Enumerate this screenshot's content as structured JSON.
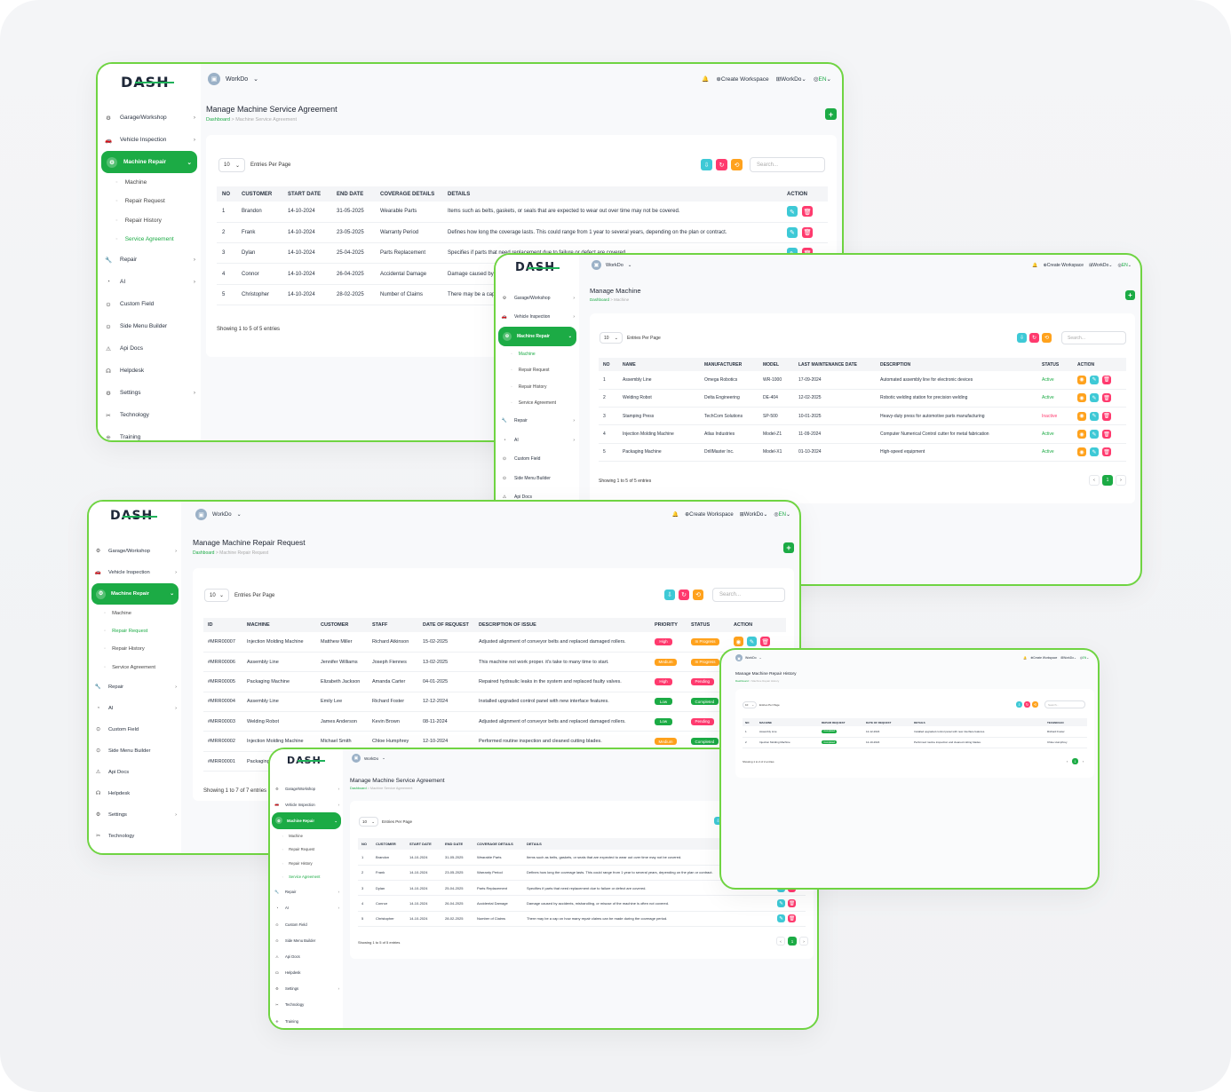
{
  "brand": {
    "logo": "DASH",
    "workspace": "WorkDo",
    "lang": "EN",
    "create_workspace": "Create Workspace",
    "accent": "#1cab45",
    "frame": "#6fd442"
  },
  "nav": {
    "garage": "Garage/Workshop",
    "vehicle": "Vehicle Inspection",
    "machine_repair": "Machine Repair",
    "sub_machine": "Machine",
    "sub_request": "Repair Request",
    "sub_history": "Repair History",
    "sub_agreement": "Service Agreement",
    "repair": "Repair",
    "ai": "AI",
    "custom_field": "Custom Field",
    "side_menu": "Side Menu Builder",
    "api_docs": "Api Docs",
    "helpdesk": "Helpdesk",
    "settings": "Settings",
    "technology": "Technology",
    "training": "Training"
  },
  "common": {
    "dashboard": "Dashboard",
    "entries_per_page": "Entries Per Page",
    "per_page_value": "10",
    "search_placeholder": "Search...",
    "page": "1"
  },
  "agreement": {
    "title": "Manage Machine Service Agreement",
    "crumb": "Machine Service Agreement",
    "columns": [
      "NO",
      "CUSTOMER",
      "START DATE",
      "END DATE",
      "COVERAGE DETAILS",
      "DETAILS",
      "ACTION"
    ],
    "rows": [
      [
        "1",
        "Brandon",
        "14-10-2024",
        "31-05-2025",
        "Wearable Parts",
        "Items such as belts, gaskets, or seals that are expected to wear out over time may not be covered."
      ],
      [
        "2",
        "Frank",
        "14-10-2024",
        "23-05-2025",
        "Warranty Period",
        "Defines how long the coverage lasts. This could range from 1 year to several years, depending on the plan or contract."
      ],
      [
        "3",
        "Dylan",
        "14-10-2024",
        "25-04-2025",
        "Parts Replacement",
        "Specifies if parts that need replacement due to failure or defect are covered."
      ],
      [
        "4",
        "Connor",
        "14-10-2024",
        "26-04-2025",
        "Accidental Damage",
        "Damage caused by accidents, mishandling, or misuse of the machine is often not covered."
      ],
      [
        "5",
        "Christopher",
        "14-10-2024",
        "28-02-2025",
        "Number of Claims",
        "There may be a cap on how many repair claims can be made during the coverage period."
      ]
    ],
    "showing": "Showing 1 to 5 of 5 entries"
  },
  "machine": {
    "title": "Manage Machine",
    "crumb": "Machine",
    "columns": [
      "NO",
      "NAME",
      "MANUFACTURER",
      "MODEL",
      "LAST MAINTENANCE DATE",
      "DESCRIPTION",
      "STATUS",
      "ACTION"
    ],
    "rows": [
      [
        "1",
        "Assembly Line",
        "Omega Robotics",
        "WR-1000",
        "17-09-2024",
        "Automated assembly line for electronic devices",
        "Active"
      ],
      [
        "2",
        "Welding Robot",
        "Delta Engineering",
        "DE-404",
        "12-02-2025",
        "Robotic welding station for precision welding",
        "Active"
      ],
      [
        "3",
        "Stamping Press",
        "TechCom Solutions",
        "SP-500",
        "10-01-2025",
        "Heavy-duty press for automotive parts manufacturing",
        "Inactive"
      ],
      [
        "4",
        "Injection Molding Machine",
        "Atlas Industries",
        "Model-Z1",
        "11-09-2024",
        "Computer Numerical Control cutter for metal fabrication",
        "Active"
      ],
      [
        "5",
        "Packaging Machine",
        "DrillMaster Inc.",
        "Model-X1",
        "01-10-2024",
        "High-speed equipment",
        "Active"
      ]
    ],
    "showing": "Showing 1 to 5 of 5 entries"
  },
  "request": {
    "title": "Manage Machine Repair Request",
    "crumb": "Machine Repair Request",
    "columns": [
      "ID",
      "MACHINE",
      "CUSTOMER",
      "STAFF",
      "DATE OF REQUEST",
      "DESCRIPTION OF ISSUE",
      "PRIORITY",
      "STATUS",
      "ACTION"
    ],
    "rows": [
      [
        "#MRR00007",
        "Injection Molding Machine",
        "Matthew Miller",
        "Richard Atkinson",
        "15-02-2025",
        "Adjusted alignment of conveyor belts and replaced damaged rollers.",
        "High",
        "In Progress"
      ],
      [
        "#MRR00006",
        "Assembly Line",
        "Jennifer Williams",
        "Joseph Fiennes",
        "13-02-2025",
        "This machine not work proper. it's take to many time to start.",
        "Medium",
        "In Progress"
      ],
      [
        "#MRR00005",
        "Packaging Machine",
        "Elizabeth Jackson",
        "Amanda Carter",
        "04-01-2025",
        "Repaired hydraulic leaks in the system and replaced faulty valves.",
        "High",
        "Pending"
      ],
      [
        "#MRR00004",
        "Assembly Line",
        "Emily Lee",
        "Richard Foster",
        "12-12-2024",
        "Installed upgraded control panel with new interface features.",
        "Low",
        "Completed"
      ],
      [
        "#MRR00003",
        "Welding Robot",
        "James Anderson",
        "Kevin Brown",
        "08-11-2024",
        "Adjusted alignment of conveyor belts and replaced damaged rollers.",
        "Low",
        "Pending"
      ],
      [
        "#MRR00002",
        "Injection Molding Machine",
        "Michael Smith",
        "Chloe Humphrey",
        "12-10-2024",
        "Performed routine inspection and cleaned cutting blades.",
        "Medium",
        "Completed"
      ],
      [
        "#MRR00001",
        "Packaging Machine",
        "",
        "",
        "",
        "",
        "",
        ""
      ]
    ],
    "showing": "Showing 1 to 7 of 7 entries"
  },
  "history": {
    "title": "Manage Machine Repair History",
    "crumb": "Machine Repair History",
    "columns": [
      "NO",
      "MACHINE",
      "REPAIR REQUEST",
      "DATE OF REQUEST",
      "DETAILS",
      "TECHNICIAN"
    ],
    "rows": [
      [
        "1",
        "Assembly Line",
        "Completed",
        "12-12-2024",
        "Installed upgraded control panel with new interface features.",
        "Richard Foster"
      ],
      [
        "2",
        "Injection Molding Machine",
        "Completed",
        "12-10-2024",
        "Performed routine inspection and cleaned cutting blades.",
        "Chloe Humphrey"
      ]
    ],
    "showing": "Showing 1 to 2 of 2 entries"
  }
}
